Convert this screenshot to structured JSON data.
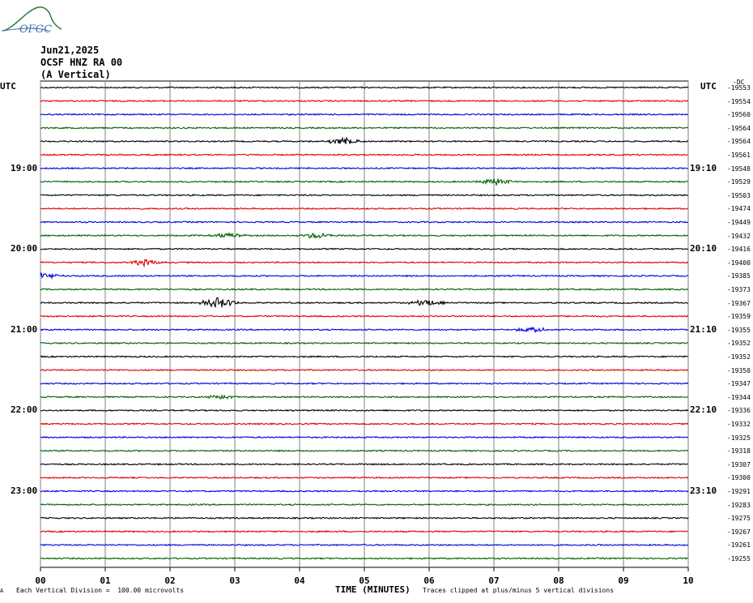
{
  "header": {
    "date": "Jun21,2025",
    "station": "OCSF HNZ RA 00",
    "component": "(A Vertical)"
  },
  "logo": {
    "text": "OFGC",
    "color": "#2b7a3a"
  },
  "utc_label_left": "UTC",
  "utc_label_right": "UTC",
  "chart_data": {
    "type": "line",
    "title": "",
    "xlabel": "TIME (MINUTES)",
    "ylabel": "",
    "x_ticks": [
      "00",
      "01",
      "02",
      "03",
      "04",
      "05",
      "06",
      "07",
      "08",
      "09",
      "10"
    ],
    "xlim": [
      0,
      10
    ],
    "grid": true,
    "trace_colors": [
      "#000000",
      "#e00000",
      "#0000e0",
      "#006000"
    ],
    "left_hour_labels": [
      {
        "row": 6,
        "label": "19:00"
      },
      {
        "row": 12,
        "label": "20:00"
      },
      {
        "row": 18,
        "label": "21:00"
      },
      {
        "row": 24,
        "label": "22:00"
      },
      {
        "row": 30,
        "label": "23:00"
      }
    ],
    "right_hour_labels": [
      {
        "row": 6,
        "label": "19:10"
      },
      {
        "row": 12,
        "label": "20:10"
      },
      {
        "row": 18,
        "label": "21:10"
      },
      {
        "row": 24,
        "label": "22:10"
      },
      {
        "row": 30,
        "label": "23:10"
      }
    ],
    "right_offsets": [
      "-19553",
      "-19554",
      "-19560",
      "-19564",
      "-19564",
      "-19561",
      "-19548",
      "-19529",
      "-19503",
      "-19474",
      "-19449",
      "-19432",
      "-19416",
      "-19400",
      "-19385",
      "-19373",
      "-19367",
      "-19359",
      "-19355",
      "-19352",
      "-19352",
      "-19350",
      "-19347",
      "-19344",
      "-19336",
      "-19332",
      "-19325",
      "-19318",
      "-19307",
      "-19300",
      "-19291",
      "-19283",
      "-19275",
      "-19267",
      "-19261",
      "-19255"
    ],
    "right_offset_header": "-DC",
    "events": [
      {
        "row": 4,
        "minute": 4.7,
        "amp": 5
      },
      {
        "row": 16,
        "minute": 2.75,
        "amp": 7
      },
      {
        "row": 16,
        "minute": 5.95,
        "amp": 4
      },
      {
        "row": 13,
        "minute": 1.62,
        "amp": 4
      },
      {
        "row": 7,
        "minute": 7.02,
        "amp": 4
      },
      {
        "row": 11,
        "minute": 2.9,
        "amp": 3
      },
      {
        "row": 11,
        "minute": 4.25,
        "amp": 4
      },
      {
        "row": 14,
        "minute": 0.05,
        "amp": 4
      },
      {
        "row": 18,
        "minute": 7.6,
        "amp": 3
      },
      {
        "row": 23,
        "minute": 2.8,
        "amp": 3
      }
    ]
  },
  "footer": {
    "left_mark": "A",
    "scale": "Each Vertical Division =  100.00 microvolts",
    "clip": "Traces clipped at plus/minus 5 vertical divisions"
  }
}
